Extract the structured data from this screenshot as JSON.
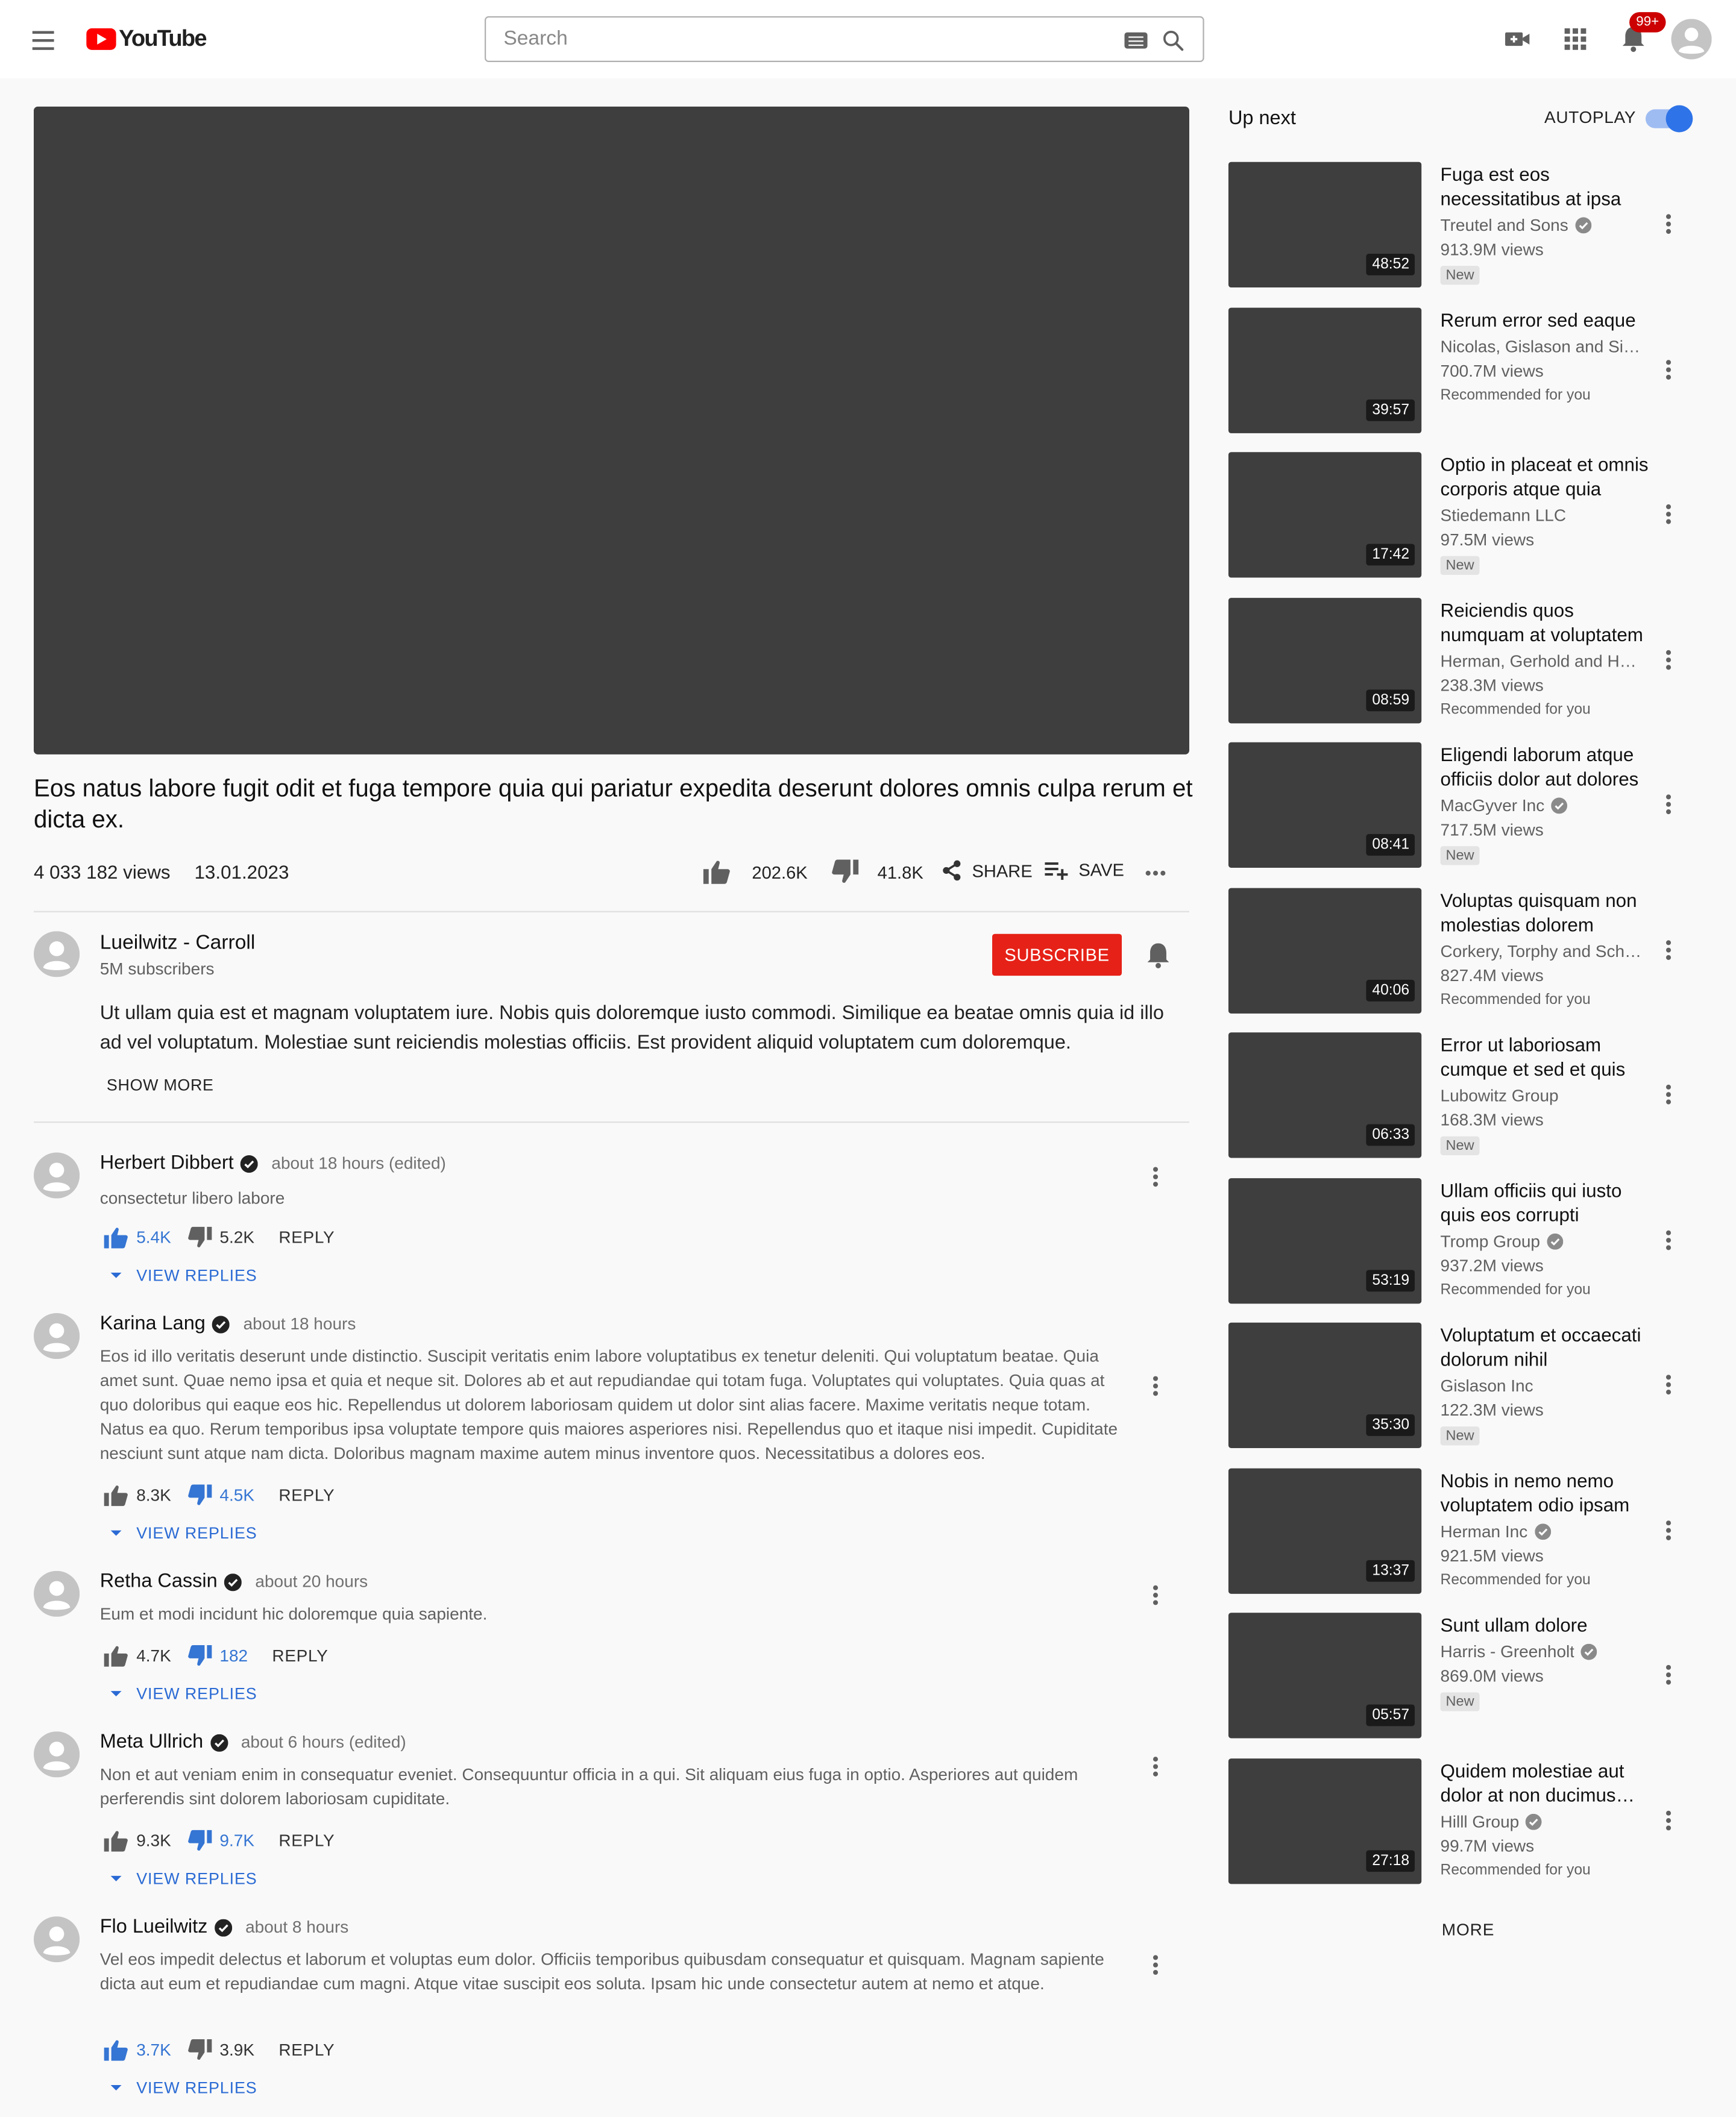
{
  "header": {
    "logo_text": "YouTube",
    "search_placeholder": "Search",
    "notification_count": "99+"
  },
  "video": {
    "title": "Eos natus labore fugit odit et fuga tempore quia qui pariatur expedita deserunt dolores omnis culpa rerum et dicta ex.",
    "views": "4 033 182 views",
    "date": "13.01.2023",
    "likes": "202.6K",
    "dislikes": "41.8K",
    "share_label": "SHARE",
    "save_label": "SAVE"
  },
  "channel": {
    "name": "Lueilwitz - Carroll",
    "subscribers": "5M subscribers",
    "subscribe_label": "SUBSCRIBE",
    "description": "Ut ullam quia est et magnam voluptatem iure. Nobis quis doloremque iusto commodi. Similique ea beatae omnis quia id illo ad vel voluptatum. Molestiae sunt reiciendis molestias officiis. Est provident aliquid voluptatem cum doloremque.",
    "show_more_label": "SHOW MORE"
  },
  "comments": [
    {
      "author": "Herbert Dibbert",
      "time": "about 18 hours (edited)",
      "text": "consectetur libero labore",
      "likes": "5.4K",
      "dislikes": "5.2K",
      "liked": true,
      "disliked": false,
      "reply_label": "REPLY",
      "view_replies_label": "VIEW REPLIES"
    },
    {
      "author": "Karina Lang",
      "time": "about 18 hours",
      "text": "Eos id illo veritatis deserunt unde distinctio. Suscipit veritatis enim labore voluptatibus ex tenetur deleniti. Qui voluptatum beatae. Quia amet sunt. Quae nemo ipsa et quia et neque sit. Dolores ab et aut repudiandae qui totam fuga. Voluptates qui voluptates. Quia quas at quo doloribus qui eaque eos hic. Repellendus ut dolorem laboriosam quidem ut dolor sint alias facere. Maxime veritatis neque totam. Natus ea quo. Rerum temporibus ipsa voluptate tempore quis maiores asperiores nisi. Repellendus quo et itaque nisi impedit. Cupiditate nesciunt sunt atque nam dicta. Doloribus magnam maxime autem minus inventore quos. Necessitatibus a dolores eos.",
      "likes": "8.3K",
      "dislikes": "4.5K",
      "liked": false,
      "disliked": true,
      "reply_label": "REPLY",
      "view_replies_label": "VIEW REPLIES"
    },
    {
      "author": "Retha Cassin",
      "time": "about 20 hours",
      "text": "Eum et modi incidunt hic doloremque quia sapiente.",
      "likes": "4.7K",
      "dislikes": "182",
      "liked": false,
      "disliked": true,
      "reply_label": "REPLY",
      "view_replies_label": "VIEW REPLIES"
    },
    {
      "author": "Meta Ullrich",
      "time": "about 6 hours (edited)",
      "text": "Non et aut veniam enim in consequatur eveniet. Consequuntur officia in a qui. Sit aliquam eius fuga in optio. Asperiores aut quidem perferendis sint dolorem laboriosam cupiditate.",
      "likes": "9.3K",
      "dislikes": "9.7K",
      "liked": false,
      "disliked": true,
      "reply_label": "REPLY",
      "view_replies_label": "VIEW REPLIES"
    },
    {
      "author": "Flo Lueilwitz",
      "time": "about 8 hours",
      "text": "Vel eos impedit delectus et laborum et voluptas eum dolor. Officiis temporibus quibusdam consequatur et quisquam. Magnam sapiente dicta aut eum et repudiandae cum magni. Atque vitae suscipit eos soluta. Ipsam hic unde consectetur autem at nemo et atque.",
      "likes": "3.7K",
      "dislikes": "3.9K",
      "liked": true,
      "disliked": false,
      "reply_label": "REPLY",
      "view_replies_label": "VIEW REPLIES"
    }
  ],
  "sidebar": {
    "up_next_label": "Up next",
    "autoplay_label": "AUTOPLAY",
    "autoplay_on": true,
    "more_label": "MORE",
    "videos": [
      {
        "title": "Fuga est eos necessitatibus at ipsa",
        "channel": "Treutel and Sons",
        "verified": true,
        "views": "913.9M views",
        "duration": "48:52",
        "tag": "New"
      },
      {
        "title": "Rerum error sed eaque",
        "channel": "Nicolas, Gislason and Simonis",
        "verified": false,
        "views": "700.7M views",
        "duration": "39:57",
        "tag": "Recommended for you"
      },
      {
        "title": "Optio in placeat et omnis corporis atque quia",
        "channel": "Stiedemann LLC",
        "verified": false,
        "views": "97.5M views",
        "duration": "17:42",
        "tag": "New"
      },
      {
        "title": "Reiciendis quos numquam at voluptatem",
        "channel": "Herman, Gerhold and Howe",
        "verified": false,
        "views": "238.3M views",
        "duration": "08:59",
        "tag": "Recommended for you"
      },
      {
        "title": "Eligendi laborum atque officiis dolor aut dolores",
        "channel": "MacGyver Inc",
        "verified": true,
        "views": "717.5M views",
        "duration": "08:41",
        "tag": "New"
      },
      {
        "title": "Voluptas quisquam non molestias dolorem",
        "channel": "Corkery, Torphy and Schmidt",
        "verified": false,
        "views": "827.4M views",
        "duration": "40:06",
        "tag": "Recommended for you"
      },
      {
        "title": "Error ut laboriosam cumque et sed et quis",
        "channel": "Lubowitz Group",
        "verified": false,
        "views": "168.3M views",
        "duration": "06:33",
        "tag": "New"
      },
      {
        "title": "Ullam officiis qui iusto quis eos corrupti",
        "channel": "Tromp Group",
        "verified": true,
        "views": "937.2M views",
        "duration": "53:19",
        "tag": "Recommended for you"
      },
      {
        "title": "Voluptatum et occaecati dolorum nihil",
        "channel": "Gislason Inc",
        "verified": false,
        "views": "122.3M views",
        "duration": "35:30",
        "tag": "New"
      },
      {
        "title": "Nobis in nemo nemo voluptatem odio ipsam",
        "channel": "Herman Inc",
        "verified": true,
        "views": "921.5M views",
        "duration": "13:37",
        "tag": "Recommended for you"
      },
      {
        "title": "Sunt ullam dolore",
        "channel": "Harris - Greenholt",
        "verified": true,
        "views": "869.0M views",
        "duration": "05:57",
        "tag": "New"
      },
      {
        "title": "Quidem molestiae aut dolor at non ducimus sunt",
        "channel": "Hilll Group",
        "verified": true,
        "views": "99.7M views",
        "duration": "27:18",
        "tag": "Recommended for you"
      }
    ]
  }
}
